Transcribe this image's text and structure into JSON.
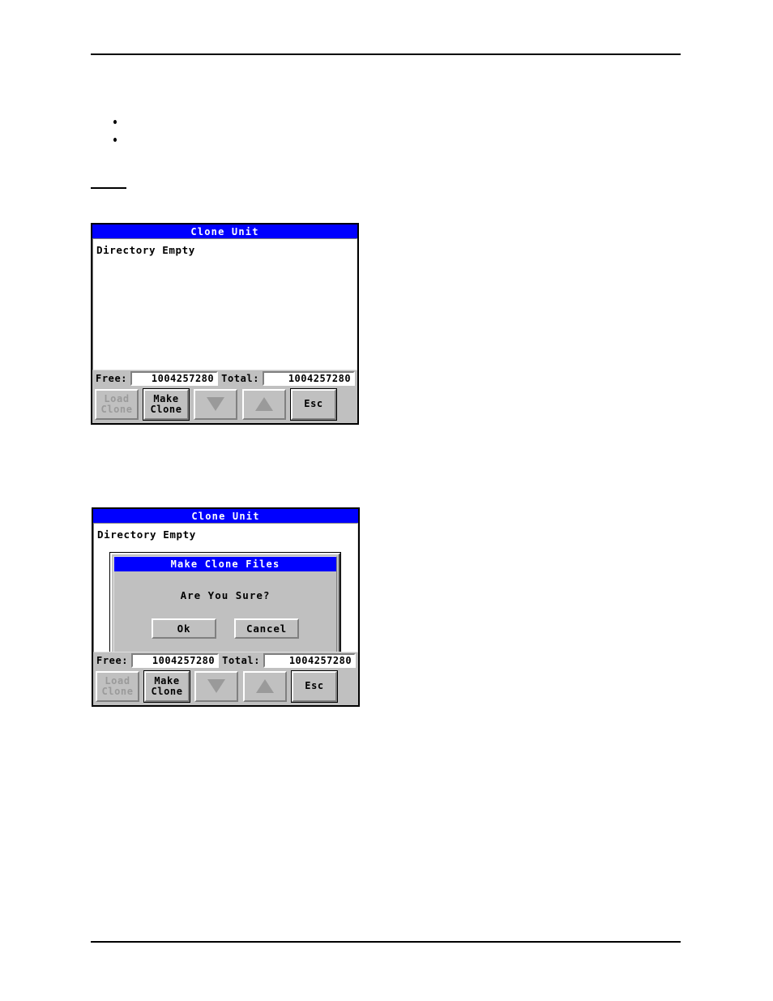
{
  "page": {
    "bullets": [
      "",
      ""
    ]
  },
  "windows": [
    {
      "title": "Clone Unit",
      "list_entry": "Directory Empty",
      "status": {
        "free_label": "Free:",
        "free_value": "1004257280",
        "total_label": "Total:",
        "total_value": "1004257280"
      },
      "buttons": {
        "load_clone": "Load\nClone",
        "load_clone_line1": "Load",
        "load_clone_line2": "Clone",
        "make_clone_line1": "Make",
        "make_clone_line2": "Clone",
        "scroll_down_icon": "triangle-down-icon",
        "scroll_up_icon": "triangle-up-icon",
        "esc": "Esc"
      }
    },
    {
      "title": "Clone Unit",
      "list_entry": "Directory Empty",
      "status": {
        "free_label": "Free:",
        "free_value": "1004257280",
        "total_label": "Total:",
        "total_value": "1004257280"
      },
      "buttons": {
        "load_clone_line1": "Load",
        "load_clone_line2": "Clone",
        "make_clone_line1": "Make",
        "make_clone_line2": "Clone",
        "scroll_down_icon": "triangle-down-icon",
        "scroll_up_icon": "triangle-up-icon",
        "esc": "Esc"
      },
      "dialog": {
        "title": "Make Clone Files",
        "message": "Are You Sure?",
        "ok_label": "Ok",
        "cancel_label": "Cancel"
      }
    }
  ],
  "colors": {
    "titlebar_blue": "#0000FF",
    "titlebar_text": "#FFFFFF",
    "window_face": "#C0C0C0",
    "list_background": "#FFFFFF",
    "disabled_text": "#9A9A9A",
    "text": "#000000"
  }
}
